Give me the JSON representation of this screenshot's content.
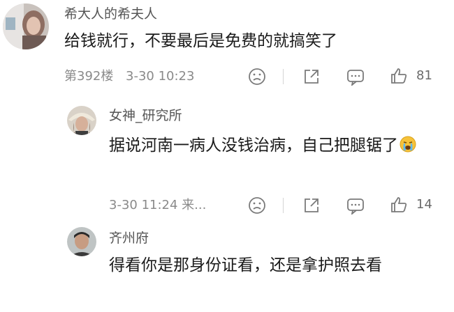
{
  "colors": {
    "background": "#ffffff",
    "username": "#555555",
    "content": "#1a1a1a",
    "meta": "#8a8a8a",
    "icon": "#7a7a7a"
  },
  "comments": [
    {
      "username": "希大人的希夫人",
      "content": "给钱就行，不要最后是免费的就搞笑了",
      "floor": "第392楼",
      "time": "3-30 10:23",
      "likes": "81",
      "avatar_icon": "user-avatar-photo"
    },
    {
      "username": "女神_研究所",
      "content": "据说河南一病人没钱治病，自己把腿锯了",
      "emoji_icon": "crying-face-emoji",
      "time": "3-30 11:24 来...",
      "likes": "14",
      "avatar_icon": "user-avatar-photo"
    },
    {
      "username": "齐州府",
      "content": "得看你是那身份证看，还是拿护照去看",
      "avatar_icon": "user-avatar-photo"
    }
  ],
  "icons": {
    "dislike": "sad-face-icon",
    "share": "share-icon",
    "comment": "comment-bubble-icon",
    "like": "thumbs-up-icon"
  }
}
